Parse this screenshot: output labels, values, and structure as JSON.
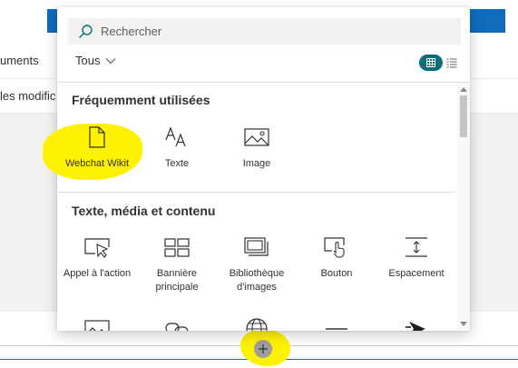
{
  "background": {
    "nav_text": "uments",
    "modified_text": "les modific"
  },
  "panel": {
    "search": {
      "placeholder": "Rechercher",
      "icon": "search-icon"
    },
    "filter": {
      "label": "Tous",
      "icon": "chevron-down-icon"
    },
    "view": {
      "active": "grid",
      "grid_icon": "grid-view-icon",
      "list_icon": "list-view-icon"
    },
    "sections": [
      {
        "title": "Fréquemment utilisées",
        "items": [
          {
            "label": "Webchat Wikit",
            "icon": "document-icon",
            "highlighted": true
          },
          {
            "label": "Texte",
            "icon": "text-icon"
          },
          {
            "label": "Image",
            "icon": "image-icon"
          }
        ]
      },
      {
        "title": "Texte, média et contenu",
        "items": [
          {
            "label": "Appel à l'action",
            "icon": "call-to-action-icon"
          },
          {
            "label": "Bannière principale",
            "icon": "hero-icon"
          },
          {
            "label": "Bibliothèque d'images",
            "icon": "image-gallery-icon"
          },
          {
            "label": "Bouton",
            "icon": "button-icon"
          },
          {
            "label": "Espacement",
            "icon": "spacer-icon"
          },
          {
            "label": "",
            "icon": "image-icon"
          },
          {
            "label": "",
            "icon": "link-icon"
          },
          {
            "label": "",
            "icon": "globe-icon"
          },
          {
            "label": "",
            "icon": "divider-icon"
          },
          {
            "label": "",
            "icon": "stream-icon"
          }
        ]
      }
    ]
  },
  "add_button": {
    "icon": "plus-icon"
  },
  "colors": {
    "accent": "#0f6e78",
    "brand_blue": "#0f6cbd",
    "highlight": "#fff200"
  }
}
